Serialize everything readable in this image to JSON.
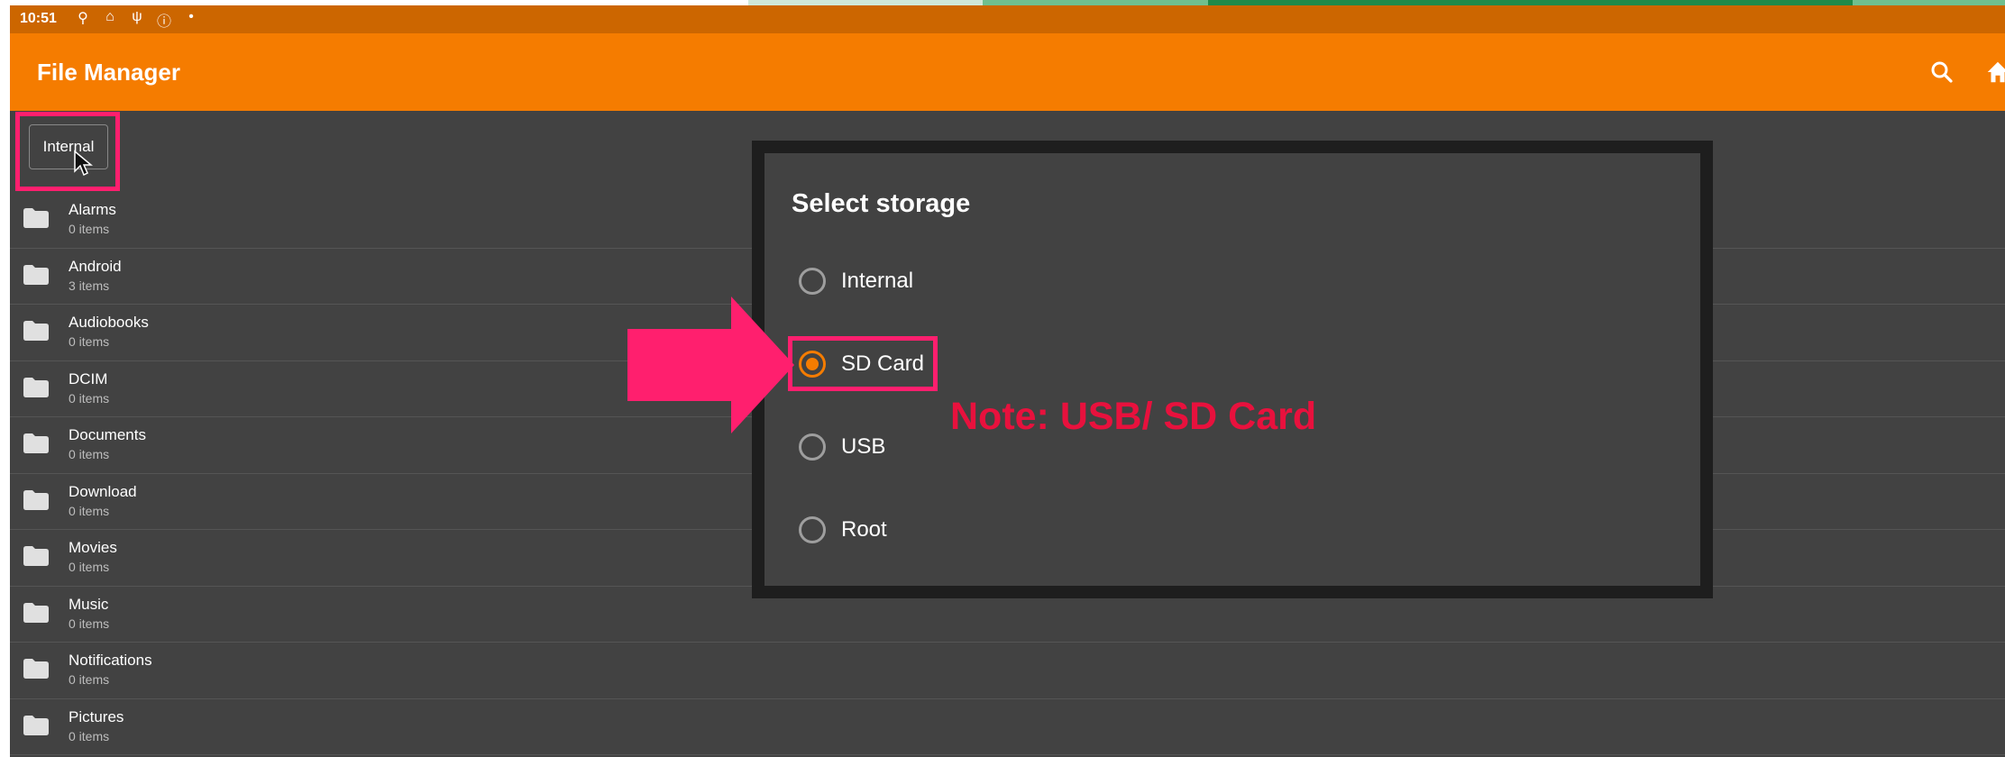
{
  "status_bar": {
    "time": "10:51"
  },
  "app_bar": {
    "title": "File Manager"
  },
  "breadcrumb": {
    "label": "Internal"
  },
  "files": [
    {
      "name": "Alarms",
      "count": "0 items"
    },
    {
      "name": "Android",
      "count": "3 items"
    },
    {
      "name": "Audiobooks",
      "count": "0 items"
    },
    {
      "name": "DCIM",
      "count": "0 items"
    },
    {
      "name": "Documents",
      "count": "0 items"
    },
    {
      "name": "Download",
      "count": "0 items"
    },
    {
      "name": "Movies",
      "count": "0 items"
    },
    {
      "name": "Music",
      "count": "0 items"
    },
    {
      "name": "Notifications",
      "count": "0 items"
    },
    {
      "name": "Pictures",
      "count": "0 items"
    }
  ],
  "dialog": {
    "title": "Select storage",
    "options": [
      {
        "label": "Internal",
        "selected": false
      },
      {
        "label": "SD Card",
        "selected": true
      },
      {
        "label": "USB",
        "selected": false
      },
      {
        "label": "Root",
        "selected": false
      }
    ]
  },
  "annotation": {
    "note": "Note: USB/ SD Card"
  },
  "colors": {
    "accent": "#f57c00",
    "highlight": "#ff1f6e",
    "note": "#e8113d"
  }
}
